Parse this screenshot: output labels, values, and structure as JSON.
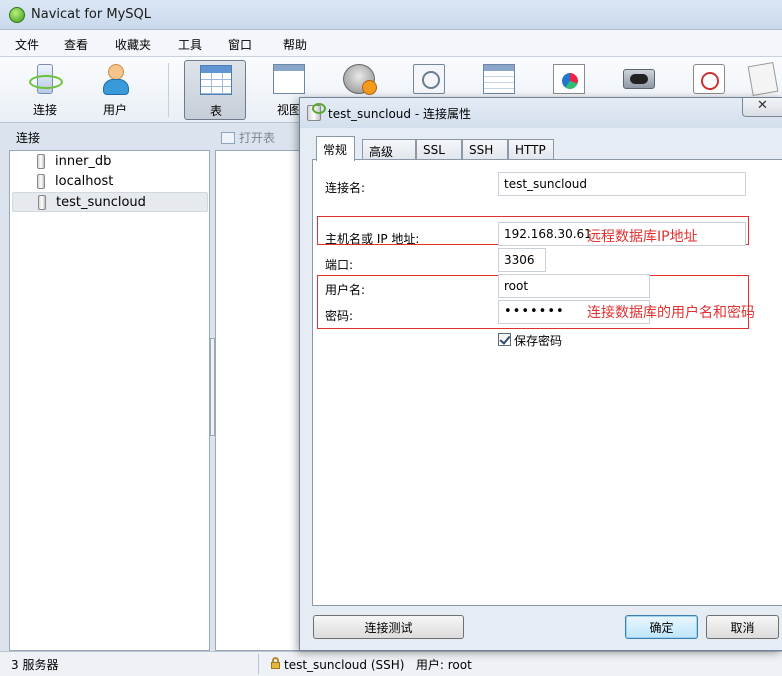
{
  "window": {
    "title": "Navicat for MySQL"
  },
  "menu": [
    "文件",
    "查看",
    "收藏夹",
    "工具",
    "窗口",
    "帮助"
  ],
  "toolbar": {
    "connection_label": "连接",
    "user_label": "用户",
    "table_label": "表",
    "view_label": "视图"
  },
  "connections": {
    "header": "连接",
    "items": [
      {
        "label": "inner_db"
      },
      {
        "label": "localhost"
      },
      {
        "label": "test_suncloud",
        "selected": true
      }
    ]
  },
  "object_toolbar": {
    "open_table": "打开表"
  },
  "status": {
    "server_count": "3 服务器",
    "connection": "test_suncloud (SSH)   用户: root"
  },
  "dialog": {
    "title": "test_suncloud - 连接属性",
    "close_glyph": "✕",
    "tabs": [
      {
        "label": "常规",
        "active": true
      },
      {
        "label": "高级"
      },
      {
        "label": "SSL"
      },
      {
        "label": "SSH"
      },
      {
        "label": "HTTP"
      }
    ],
    "fields": {
      "connection_name": {
        "label": "连接名:",
        "value": "test_suncloud"
      },
      "host": {
        "label": "主机名或 IP 地址:",
        "value": "192.168.30.61"
      },
      "port": {
        "label": "端口:",
        "value": "3306"
      },
      "username": {
        "label": "用户名:",
        "value": "root"
      },
      "password": {
        "label": "密码:",
        "value": "•••••••"
      }
    },
    "save_password": {
      "label": "保存密码",
      "checked": true
    },
    "buttons": {
      "test": "连接测试",
      "ok": "确定",
      "cancel": "取消"
    }
  },
  "annotations": {
    "host_note": "远程数据库IP地址",
    "credentials_note": "连接数据库的用户名和密码"
  },
  "colors": {
    "annotation": "#e03131",
    "accent": "#3c7fb1"
  }
}
